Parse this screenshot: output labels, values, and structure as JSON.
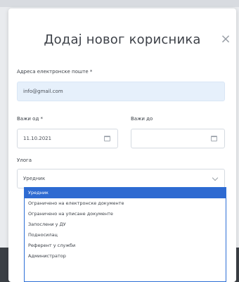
{
  "modal": {
    "title": "Додај новог корисника",
    "close": "×"
  },
  "form": {
    "email": {
      "label": "Адреса електронске поште *",
      "value": "info@gmail.com"
    },
    "valid_from": {
      "label": "Важи од *",
      "value": "11.10.2021"
    },
    "valid_to": {
      "label": "Важи до",
      "value": ""
    },
    "role": {
      "label": "Улога",
      "value": "Уредник"
    }
  },
  "dropdown": {
    "options": [
      "Уредник",
      "Ограничено на електронске документе",
      "Ограничено на уписане документе",
      "Запослени у ДУ",
      "Подносилац",
      "Референт у служби",
      "Администратор"
    ],
    "selected_index": 0
  },
  "colors": {
    "accent": "#2e6ad1",
    "highlight_field": "#e6f0fb"
  }
}
